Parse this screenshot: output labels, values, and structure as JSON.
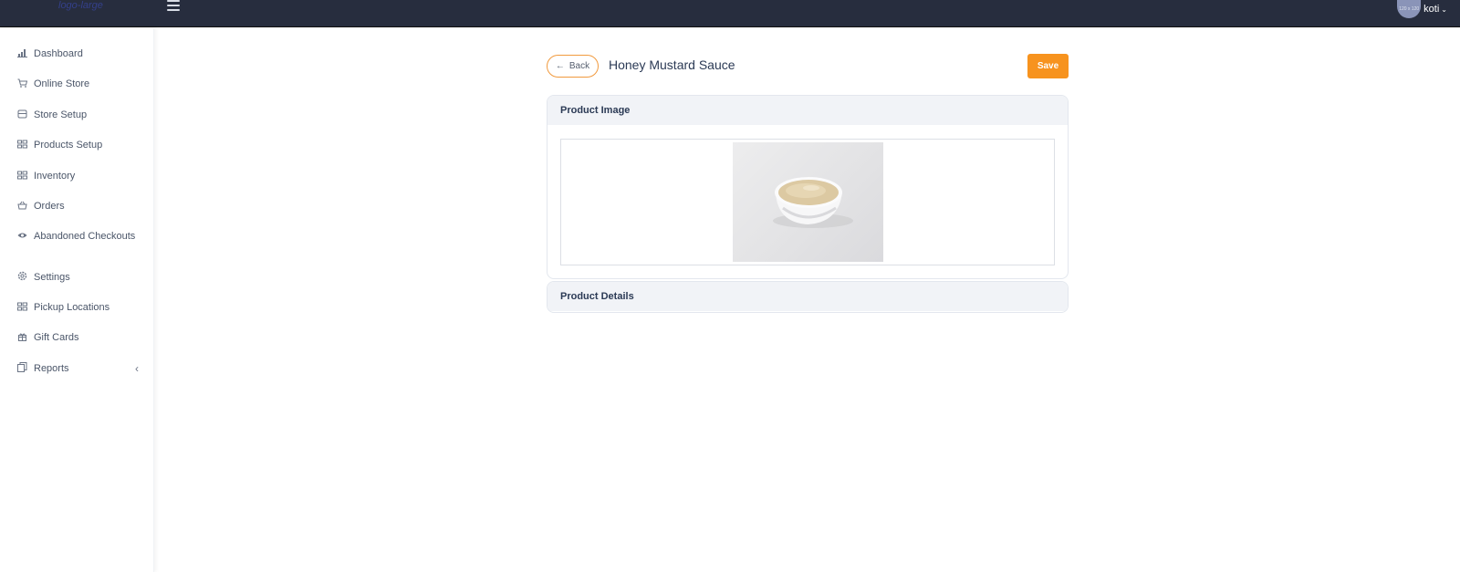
{
  "app": {
    "logo_text": "logo-large"
  },
  "user": {
    "avatar_text": "120 x 120",
    "name": "koti"
  },
  "sidebar": {
    "items": [
      {
        "label": "Dashboard",
        "icon": "bar-chart-icon"
      },
      {
        "label": "Online Store",
        "icon": "cart-icon"
      },
      {
        "label": "Store Setup",
        "icon": "store-icon"
      },
      {
        "label": "Products Setup",
        "icon": "grid-icon"
      },
      {
        "label": "Inventory",
        "icon": "grid-icon"
      },
      {
        "label": "Orders",
        "icon": "basket-icon"
      },
      {
        "label": "Abandoned Checkouts",
        "icon": "eye-icon"
      },
      {
        "label": "Settings",
        "icon": "gear-icon"
      },
      {
        "label": "Pickup Locations",
        "icon": "grid-icon"
      },
      {
        "label": "Gift Cards",
        "icon": "gift-icon"
      },
      {
        "label": "Reports",
        "icon": "report-icon"
      }
    ]
  },
  "header": {
    "back_label": "Back",
    "title": "Honey Mustard Sauce",
    "save_label": "Save"
  },
  "sections": {
    "image_title": "Product Image",
    "details_title": "Product Details"
  },
  "colors": {
    "topbar": "#272d3e",
    "accent": "#f7931e",
    "card_header": "#f1f3f7"
  }
}
